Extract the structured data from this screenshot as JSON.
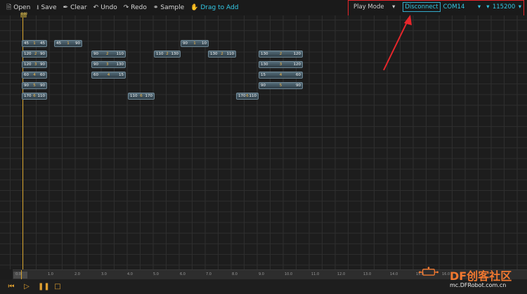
{
  "toolbar": {
    "open": "Open",
    "save": "Save",
    "clear": "Clear",
    "undo": "Undo",
    "redo": "Redo",
    "sample": "Sample",
    "drag": "Drag to Add"
  },
  "connection": {
    "play_mode": "Play Mode",
    "disconnect": "Disconnect",
    "port": "COM14",
    "baud": "115200"
  },
  "timeline": {
    "marker": "0.00",
    "blocks": [
      {
        "a": "45",
        "b": "1",
        "c": "45"
      },
      {
        "a": "45",
        "b": "1",
        "c": "90"
      },
      {
        "a": "90",
        "b": "1",
        "c": "10"
      },
      {
        "a": "120",
        "b": "2",
        "c": "90"
      },
      {
        "a": "90",
        "b": "2",
        "c": "110"
      },
      {
        "a": "110",
        "b": "2",
        "c": "130"
      },
      {
        "a": "130",
        "b": "2",
        "c": "110"
      },
      {
        "a": "130",
        "b": "2",
        "c": "120"
      },
      {
        "a": "120",
        "b": "3",
        "c": "90"
      },
      {
        "a": "90",
        "b": "3",
        "c": "130"
      },
      {
        "a": "130",
        "b": "3",
        "c": "120"
      },
      {
        "a": "60",
        "b": "4",
        "c": "60"
      },
      {
        "a": "60",
        "b": "4",
        "c": "15"
      },
      {
        "a": "15",
        "b": "4",
        "c": "60"
      },
      {
        "a": "90",
        "b": "5",
        "c": "90"
      },
      {
        "a": "90",
        "b": "5",
        "c": "90"
      },
      {
        "a": "170",
        "b": "6",
        "c": "110"
      },
      {
        "a": "110",
        "b": "6",
        "c": "170"
      },
      {
        "a": "170",
        "b": "6",
        "c": "110"
      }
    ]
  },
  "ruler": {
    "ticks": [
      "0.0",
      "1.0",
      "2.0",
      "3.0",
      "4.0",
      "5.0",
      "6.0",
      "7.0",
      "8.0",
      "9.0",
      "10.0",
      "11.0",
      "12.0",
      "13.0",
      "14.0",
      "15.0",
      "16.0"
    ]
  },
  "watermark": {
    "brand": "DF创客社区",
    "url": "mc.DFRobot.com.cn"
  },
  "colors": {
    "accent": "#33c9e6",
    "highlight": "#e8262b",
    "playhead": "#d4a12a"
  },
  "icons": [
    "file-icon",
    "download-icon",
    "broom-icon",
    "undo-icon",
    "redo-icon",
    "link-icon",
    "drag-hand-icon",
    "chevron-down-icon",
    "skip-back-icon",
    "play-icon",
    "pause-icon",
    "stop-icon"
  ]
}
